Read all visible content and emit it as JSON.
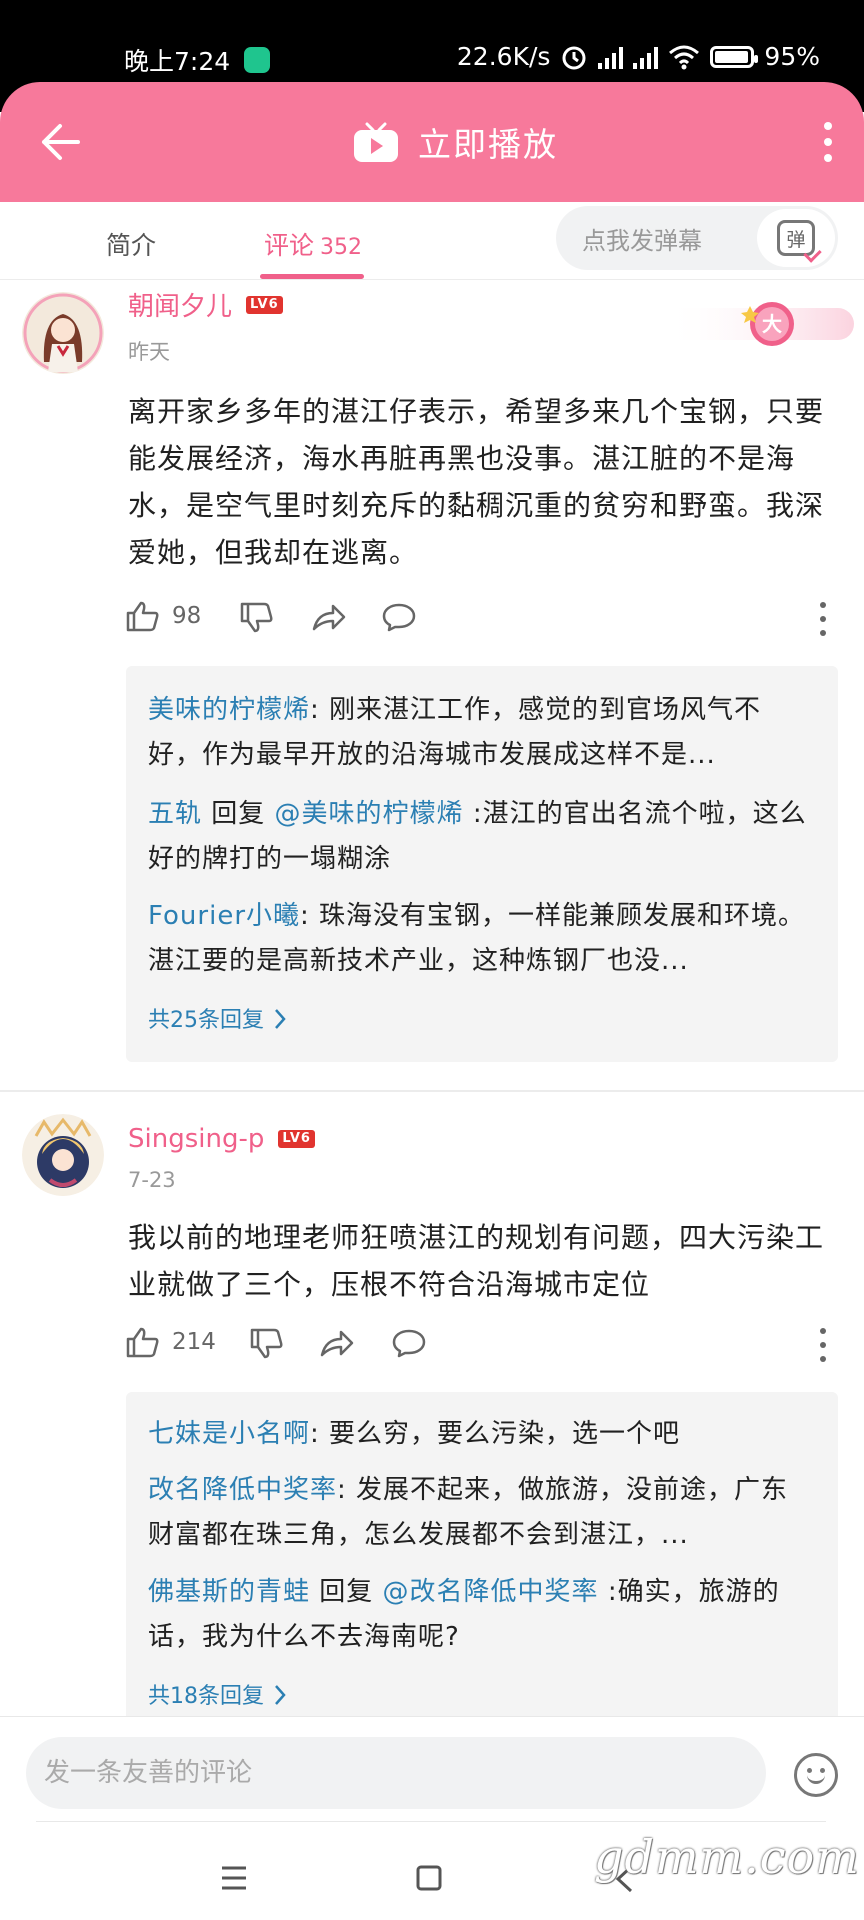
{
  "status_bar": {
    "time": "晚上7:24",
    "speed": "22.6K/s",
    "battery": "95%",
    "battery_fraction": 0.95
  },
  "header": {
    "title": "立即播放"
  },
  "tabs": {
    "intro": "简介",
    "comments": "评论",
    "comments_count": "352",
    "danmu_placeholder": "点我发弹幕",
    "danmu_icon_text": "弹"
  },
  "comments": [
    {
      "username": "朝闻夕儿",
      "level": "LV6",
      "time": "昨天",
      "badge_text": "大",
      "text": "离开家乡多年的湛江仔表示，希望多来几个宝钢，只要能发展经济，海水再脏再黑也没事。湛江脏的不是海水，是空气里时刻充斥的黏稠沉重的贫穷和野蛮。我深爱她，但我却在逃离。",
      "likes": "98",
      "replies": [
        {
          "name": "美味的柠檬烯",
          "sep": ": ",
          "text": "刚来湛江工作，感觉的到官场风气不好，作为最早开放的沿海城市发展成这样不是..."
        },
        {
          "name": "五轨",
          "reply_word": " 回复 ",
          "mention": "@美味的柠檬烯",
          "text": " :湛江的官出名流个啦，这么好的牌打的一塌糊涂"
        },
        {
          "name": "Fourier小曦",
          "sep": ": ",
          "text": "珠海没有宝钢，一样能兼顾发展和环境。湛江要的是高新技术产业，这种炼钢厂也没..."
        }
      ],
      "more_replies": "共25条回复"
    },
    {
      "username": "Singsing-p",
      "level": "LV6",
      "time": "7-23",
      "text": "我以前的地理老师狂喷湛江的规划有问题，四大污染工业就做了三个，压根不符合沿海城市定位",
      "likes": "214",
      "replies": [
        {
          "name": "七妹是小名啊",
          "sep": ": ",
          "text": "要么穷，要么污染，选一个吧"
        },
        {
          "name": "改名降低中奖率",
          "sep": ": ",
          "text": "发展不起来，做旅游，没前途，广东财富都在珠三角，怎么发展都不会到湛江，..."
        },
        {
          "name": "佛基斯的青蛙",
          "reply_word": " 回复 ",
          "mention": "@改名降低中奖率",
          "text": " :确实，旅游的话，我为什么不去海南呢?"
        }
      ],
      "more_replies": "共18条回复"
    }
  ],
  "bottom": {
    "input_placeholder": "发一条友善的评论"
  },
  "watermark": "gdmm.com",
  "colors": {
    "accent_pink": "#f7799b",
    "name_pink": "#f0608a",
    "reply_blue": "#2b7fb3"
  }
}
